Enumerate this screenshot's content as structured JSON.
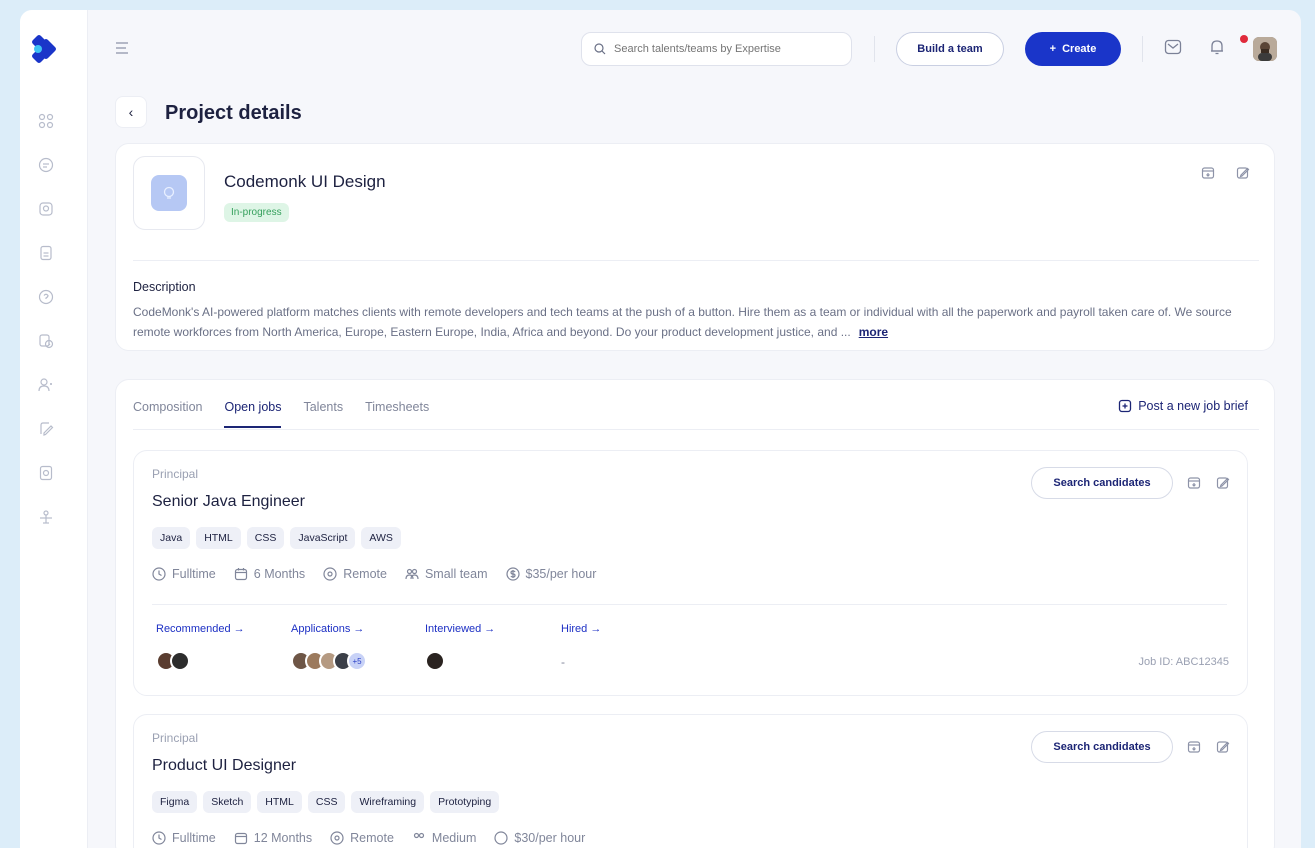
{
  "header": {
    "search_placeholder": "Search talents/teams by Expertise",
    "build_team_label": "Build a team",
    "create_label": "Create",
    "create_icon": "plus-icon"
  },
  "page": {
    "title": "Project details"
  },
  "project": {
    "name": "Codemonk UI Design",
    "status": "In-progress",
    "description_label": "Description",
    "description": "CodeMonk's AI-powered platform matches clients with remote developers and tech teams at the push of a button. Hire them as a team or individual with all the paperwork and payroll taken care of. We source remote workforces from North America, Europe, Eastern Europe, India, Africa and beyond. Do your product development justice, and ...",
    "more_label": "more"
  },
  "tabs": [
    {
      "label": "Composition",
      "active": false
    },
    {
      "label": "Open jobs",
      "active": true
    },
    {
      "label": "Talents",
      "active": false
    },
    {
      "label": "Timesheets",
      "active": false
    }
  ],
  "post_job_label": "Post a new job brief",
  "jobs": [
    {
      "level": "Principal",
      "title": "Senior Java Engineer",
      "skills": [
        "Java",
        "HTML",
        "CSS",
        "JavaScript",
        "AWS"
      ],
      "type": "Fulltime",
      "duration": "6 Months",
      "location": "Remote",
      "team_size": "Small team",
      "rate": "$35/per hour",
      "search_label": "Search candidates",
      "pipeline": {
        "recommended": "Recommended →",
        "applications": "Applications →",
        "interviewed": "Interviewed →",
        "hired": "Hired →"
      },
      "applications_more": "+5",
      "hired_value": "-",
      "job_id": "Job ID: ABC12345"
    },
    {
      "level": "Principal",
      "title": "Product UI Designer",
      "skills": [
        "Figma",
        "Sketch",
        "HTML",
        "CSS",
        "Wireframing",
        "Prototyping"
      ],
      "type": "Fulltime",
      "duration": "12 Months",
      "location": "Remote",
      "team_size": "Medium",
      "rate": "$30/per hour",
      "search_label": "Search candidates"
    }
  ],
  "colors": {
    "primary": "#1a35c9",
    "navy": "#1c2575",
    "status_bg": "#def5e6",
    "status_text": "#36a05d",
    "page_bg": "#dcedf9"
  }
}
